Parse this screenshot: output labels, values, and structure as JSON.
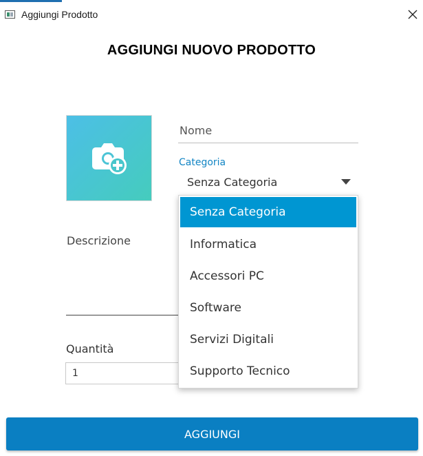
{
  "window": {
    "title": "Aggiungi Prodotto",
    "close_glyph": "✕",
    "app_icon": "window-app-icon"
  },
  "page": {
    "title": "AGGIUNGI NUOVO PRODOTTO"
  },
  "image_picker": {
    "icon": "camera-add-icon",
    "colors": {
      "gradient_start": "#4cbfe6",
      "gradient_end": "#45ccbd"
    }
  },
  "form": {
    "nome": {
      "placeholder": "Nome",
      "value": ""
    },
    "categoria": {
      "label": "Categoria",
      "selected": "Senza Categoria",
      "options": [
        "Senza Categoria",
        "Informatica",
        "Accessori PC",
        "Software",
        "Servizi Digitali",
        "Supporto Tecnico"
      ],
      "dropdown_open": true
    },
    "descrizione": {
      "label": "Descrizione",
      "value": ""
    },
    "quantita": {
      "label": "Quantità",
      "value": "1"
    }
  },
  "actions": {
    "submit_label": "AGGIUNGI"
  },
  "colors": {
    "accent": "#0a7fc2",
    "selected_option": "#0096d2",
    "floating_label": "#1285c4"
  }
}
